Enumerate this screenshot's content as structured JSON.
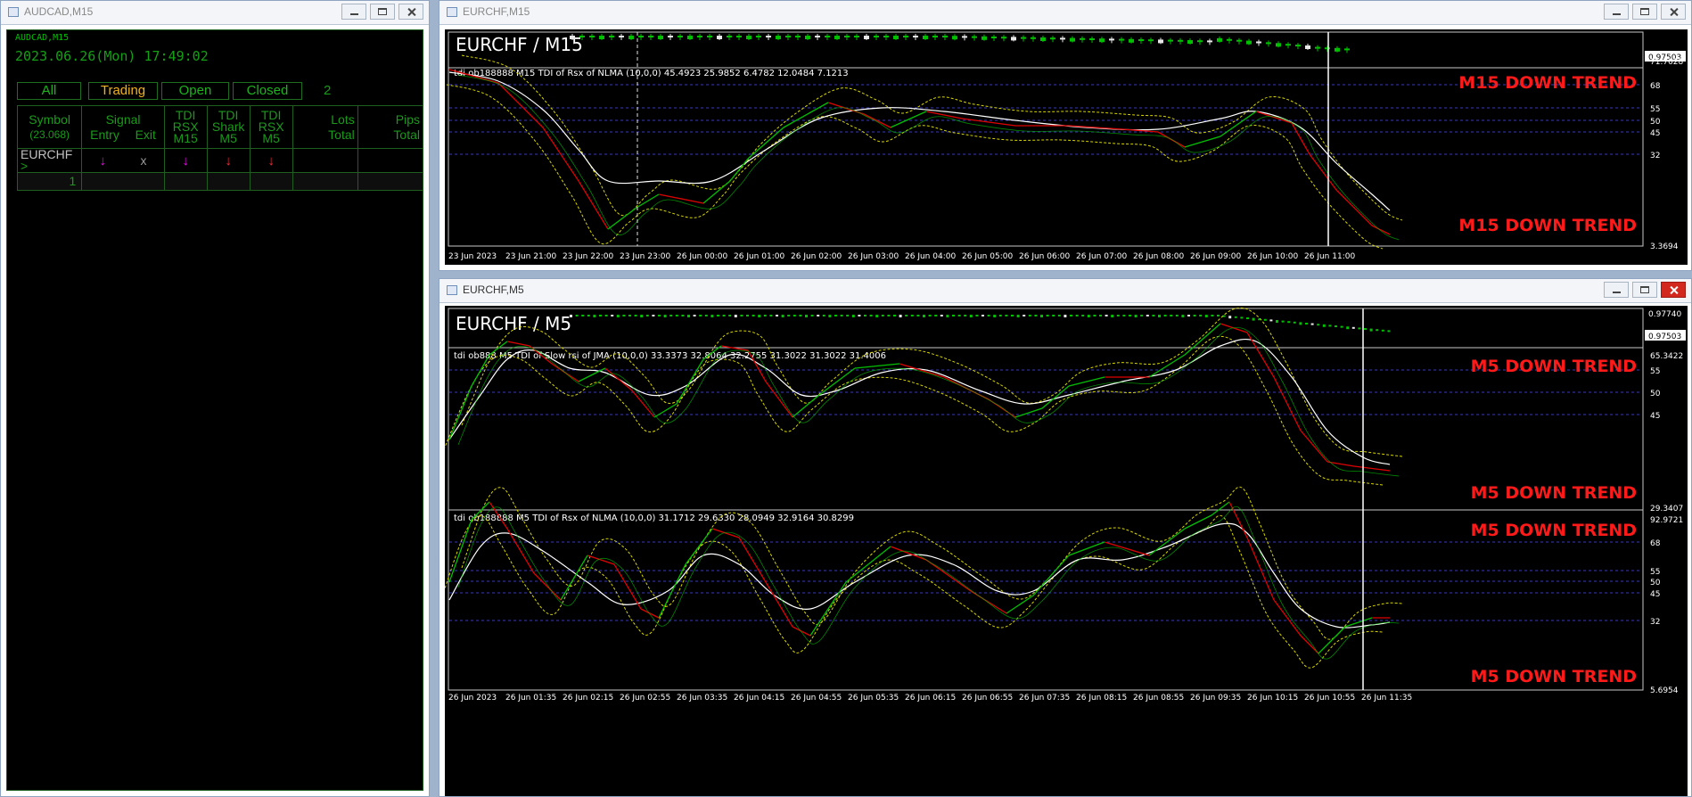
{
  "left_window": {
    "title": "AUDCAD,M15",
    "chart_label": "AUDCAD,M15",
    "datetime": "2023.06.26(Mon) 17:49:02",
    "tabs": [
      {
        "label": "All",
        "active": false
      },
      {
        "label": "Trading",
        "active": true
      },
      {
        "label": "Open",
        "active": false
      },
      {
        "label": "Closed",
        "active": false
      }
    ],
    "count": "2",
    "table": {
      "headers": {
        "symbol": "Symbol",
        "symbol_sub": "(23.068)",
        "signal": "Signal",
        "entry": "Entry",
        "exit": "Exit",
        "tdi_rsx_m15": [
          "TDI",
          "RSX",
          "M15"
        ],
        "tdi_shark_m5": [
          "TDI",
          "Shark",
          "M5"
        ],
        "tdi_rsx_m5": [
          "TDI",
          "RSX",
          "M5"
        ],
        "lots": [
          "Lots",
          "Total"
        ],
        "pips": [
          "Pips",
          "Total"
        ]
      },
      "row": {
        "symbol": "EURCHF",
        "marker": ">",
        "entry": "↓",
        "exit": "x",
        "rsx_m15": "↓",
        "shark_m5": "↓",
        "rsx_m5": "↓"
      },
      "total_row_count": "1"
    }
  },
  "m15_window": {
    "title": "EURCHF,M15",
    "symbol_label": "EURCHF / M15",
    "price_label": "0.97503",
    "indicator_label": "tdi ob188888 M15 TDI of Rsx of NLMA (10,0,0) 45.4923 25.9852 6.4782 12.0484 7.1213",
    "trend_top": "M15 DOWN TREND",
    "trend_bottom": "M15 DOWN TREND",
    "y_labels": [
      "71.7628",
      "68",
      "55",
      "50",
      "45",
      "32",
      "3.3694"
    ],
    "x_labels": [
      "23 Jun 2023",
      "23 Jun 21:00",
      "23 Jun 22:00",
      "23 Jun 23:00",
      "26 Jun 00:00",
      "26 Jun 01:00",
      "26 Jun 02:00",
      "26 Jun 03:00",
      "26 Jun 04:00",
      "26 Jun 05:00",
      "26 Jun 06:00",
      "26 Jun 07:00",
      "26 Jun 08:00",
      "26 Jun 09:00",
      "26 Jun 10:00",
      "26 Jun 11:00"
    ]
  },
  "m5_window": {
    "title": "EURCHF,M5",
    "symbol_label": "EURCHF / M5",
    "price_top": "0.97740",
    "price_label": "0.97503",
    "indicator1_label": "tdi ob888 M5 TDI of Slow rsi of JMA (10,0,0) 33.3373 32.8064 32.2755 31.3022 31.3022 31.4006",
    "indicator2_label": "tdi ob188888 M5 TDI of Rsx of NLMA (10,0,0) 31.1712 29.6330 28.0949 32.9164 30.8299",
    "trend1_top": "M5 DOWN TREND",
    "trend1_bottom": "M5 DOWN TREND",
    "trend2_top": "M5 DOWN TREND",
    "trend2_bottom": "M5 DOWN TREND",
    "y1_labels": [
      "65.3422",
      "55",
      "50",
      "45",
      "29.3407"
    ],
    "y2_labels": [
      "92.9721",
      "68",
      "55",
      "50",
      "45",
      "32",
      "5.6954"
    ],
    "x_labels": [
      "26 Jun 2023",
      "26 Jun 01:35",
      "26 Jun 02:15",
      "26 Jun 02:55",
      "26 Jun 03:35",
      "26 Jun 04:15",
      "26 Jun 04:55",
      "26 Jun 05:35",
      "26 Jun 06:15",
      "26 Jun 06:55",
      "26 Jun 07:35",
      "26 Jun 08:15",
      "26 Jun 08:55",
      "26 Jun 09:35",
      "26 Jun 10:15",
      "26 Jun 10:55",
      "26 Jun 11:35"
    ]
  },
  "colors": {
    "trend": "#ff1a1a",
    "green": "#00c000",
    "red": "#e00000",
    "white": "#ffffff",
    "yellow": "#d6d600",
    "grid": "#3a3aa8",
    "magenta": "#ff00ff"
  }
}
